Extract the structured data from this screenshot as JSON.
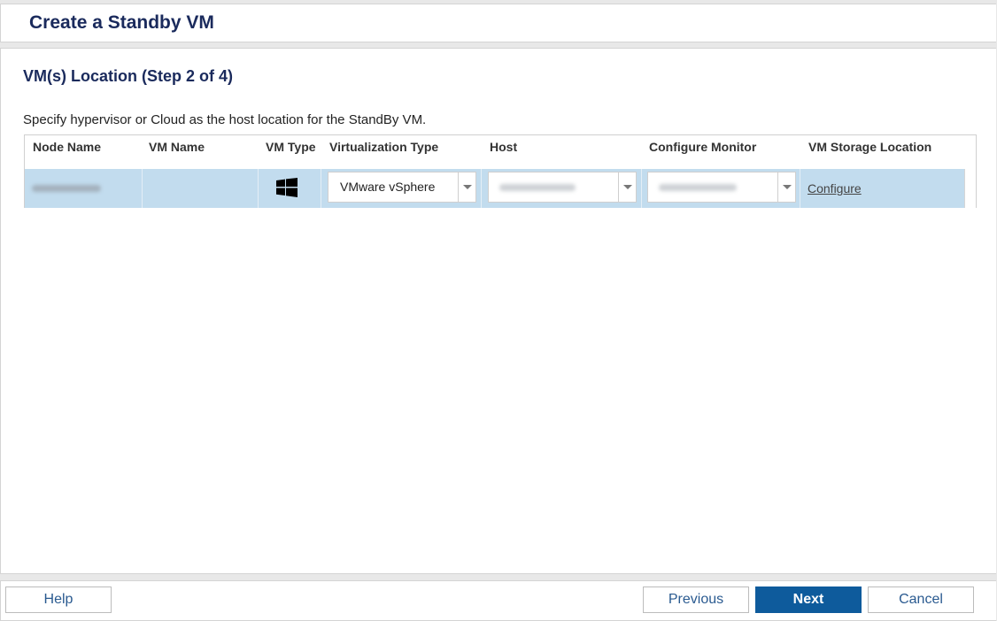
{
  "window": {
    "title": "Create a Standby VM"
  },
  "step": {
    "title": "VM(s) Location (Step 2 of 4)",
    "instruction": "Specify hypervisor or Cloud as the host location for the StandBy VM."
  },
  "table": {
    "headers": {
      "node_name": "Node Name",
      "vm_name": "VM Name",
      "vm_type": "VM Type",
      "virtualization_type": "Virtualization Type",
      "host": "Host",
      "configure_monitor": "Configure Monitor",
      "vm_storage_location": "VM Storage Location"
    },
    "rows": [
      {
        "vm_type_icon": "windows-icon",
        "virtualization_type": "VMware vSphere",
        "storage_link": "Configure"
      }
    ]
  },
  "footer": {
    "help": "Help",
    "previous": "Previous",
    "next": "Next",
    "cancel": "Cancel"
  },
  "colors": {
    "title": "#1a2a5c",
    "row_selected": "#c2dcee",
    "primary_button": "#0e5b9c"
  }
}
